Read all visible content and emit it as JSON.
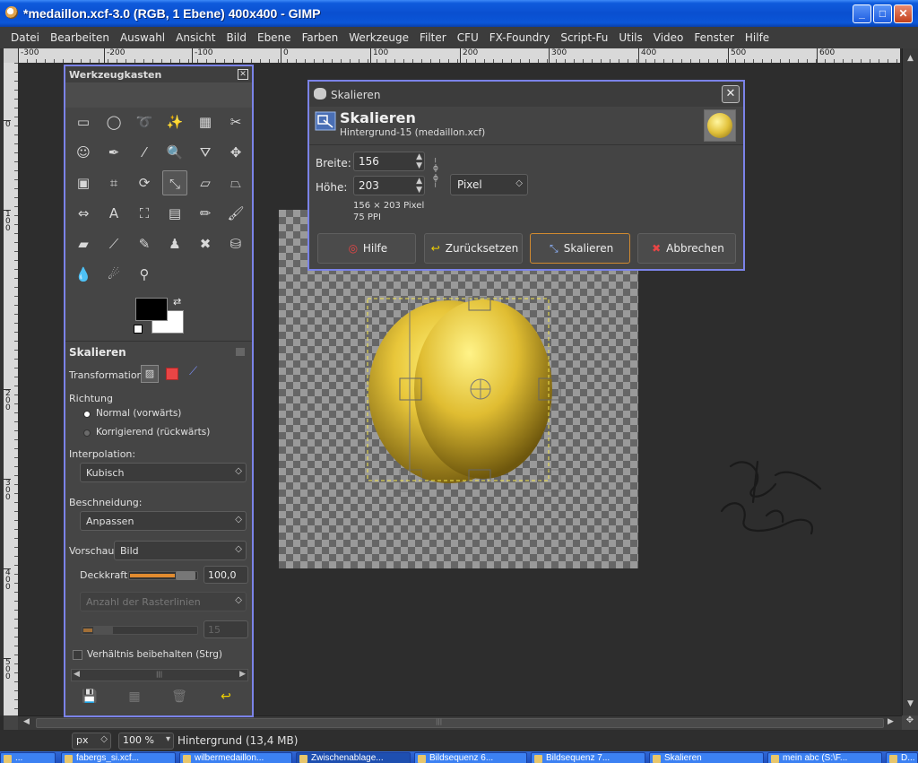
{
  "window": {
    "title": "*medaillon.xcf-3.0 (RGB, 1 Ebene) 400x400 - GIMP",
    "minimize": "_",
    "maximize": "□",
    "close": "✕"
  },
  "menu": {
    "items": [
      "Datei",
      "Bearbeiten",
      "Auswahl",
      "Ansicht",
      "Bild",
      "Ebene",
      "Farben",
      "Werkzeuge",
      "Filter",
      "CFU",
      "FX-Foundry",
      "Script-Fu",
      "Utils",
      "Video",
      "Fenster",
      "Hilfe"
    ]
  },
  "ruler": {
    "h_labels": [
      "-300",
      "-200",
      "-100",
      "0",
      "100",
      "200",
      "300",
      "400",
      "500",
      "600"
    ],
    "v_labels": [
      "0",
      "100",
      "200",
      "300",
      "400",
      "500"
    ]
  },
  "toolbox": {
    "title": "Werkzeugkasten",
    "close": "✕",
    "options_title": "Skalieren",
    "transformation_label": "Transformation:",
    "direction_label": "Richtung",
    "direction_options": [
      "Normal (vorwärts)",
      "Korrigierend (rückwärts)"
    ],
    "direction_selected": 0,
    "interpolation_label": "Interpolation:",
    "interpolation_value": "Kubisch",
    "clipping_label": "Beschneidung:",
    "clipping_value": "Anpassen",
    "preview_label": "Vorschau:",
    "preview_value": "Bild",
    "opacity_label": "Deckkraft:",
    "opacity_value": "100,0",
    "opacity_fraction": 1.0,
    "grid_lines_placeholder": "Anzahl der Rasterlinien",
    "grid_lines_value": "15",
    "keep_ratio_label": "Verhältnis beibehalten (Strg)",
    "keep_ratio_checked": false
  },
  "dialog": {
    "title": "Skalieren",
    "close": "✕",
    "heading": "Skalieren",
    "subheading": "Hintergrund-15 (medaillon.xcf)",
    "width_label": "Breite:",
    "width_value": "156",
    "height_label": "Höhe:",
    "height_value": "203",
    "unit": "Pixel",
    "size_info": "156 × 203 Pixel",
    "resolution_info": "75 PPI",
    "buttons": {
      "help": "Hilfe",
      "reset": "Zurücksetzen",
      "scale": "Skalieren",
      "cancel": "Abbrechen"
    }
  },
  "statusbar": {
    "unit": "px",
    "zoom": "100 %",
    "info": "Hintergrund (13,4 MB)"
  },
  "taskbar": {
    "items": [
      "...",
      "fabergs_si.xcf...",
      "wilbermedaillon...",
      "Zwischenablage...",
      "Bildsequenz 6...",
      "Bildsequenz 7...",
      "Skalieren",
      "mein abc (S:\\F...",
      "D..."
    ],
    "active_index": 3
  },
  "colors": {
    "xp_blue": "#0a4fd0",
    "dialog_border": "#7b83e8",
    "foreground": "#000000",
    "background": "#ffffff",
    "accent_orange": "#e18b2f"
  }
}
